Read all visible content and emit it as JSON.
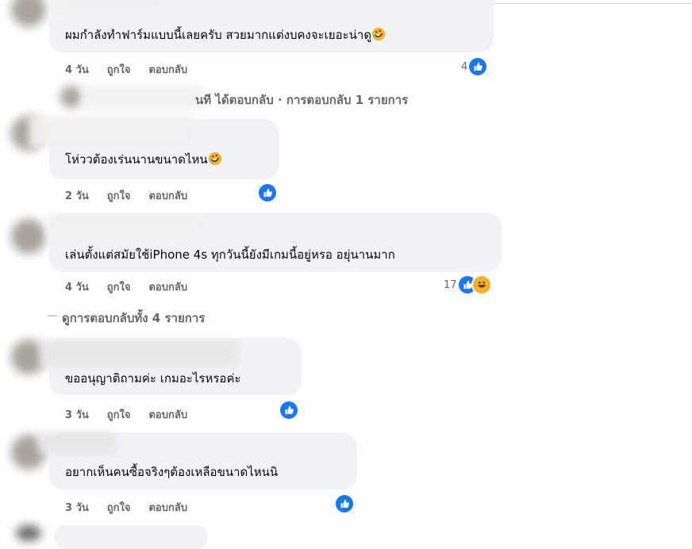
{
  "colors": {
    "accent": "#1877f2",
    "bubble": "#f0f2f5",
    "meta": "#65676b",
    "haha": "#f7b125"
  },
  "comments": [
    {
      "text": "ผมกำลังทำฟาร์มแบบนี้เลยครับ สวยมากแต่งบคงจะเยอะน่าดู",
      "emoji": "rolling-laughing-emoji",
      "time": "4 วัน",
      "like": "ถูกใจ",
      "reply": "ตอบกลับ",
      "reaction_count": "4",
      "reactions": [
        "like"
      ]
    },
    {
      "text": "โห่ววต้องเร่นนานขนาดไหน",
      "emoji": "rolling-laughing-emoji",
      "time": "2 วัน",
      "like": "ถูกใจ",
      "reply": "ตอบกลับ",
      "reaction_count": "",
      "reactions": [
        "like"
      ]
    },
    {
      "text": "เล่นตั้งแต่สมัยใช้iPhone 4s ทุกวันนี้ยังมีเกมนี้อยู่หรอ อยุ่นานมาก",
      "time": "4 วัน",
      "like": "ถูกใจ",
      "reply": "ตอบกลับ",
      "reaction_count": "17",
      "reactions": [
        "like",
        "haha"
      ]
    },
    {
      "text": "ขออนุญาติถามค่ะ เกมอะไรหรอค่ะ",
      "time": "3 วัน",
      "like": "ถูกใจ",
      "reply": "ตอบกลับ",
      "reaction_count": "",
      "reactions": [
        "like"
      ]
    },
    {
      "text": "อยากเห็นคนซื้อจริงๆต้องเหลือขนาดไหนนิ",
      "time": "3 วัน",
      "like": "ถูกใจ",
      "reply": "ตอบกลับ",
      "reaction_count": "",
      "reactions": [
        "like"
      ]
    }
  ],
  "reply_summary": "นที ได้ตอบกลับ · การตอบกลับ 1 รายการ",
  "view_all_replies": "ดูการตอบกลับทั้ง 4 รายการ"
}
